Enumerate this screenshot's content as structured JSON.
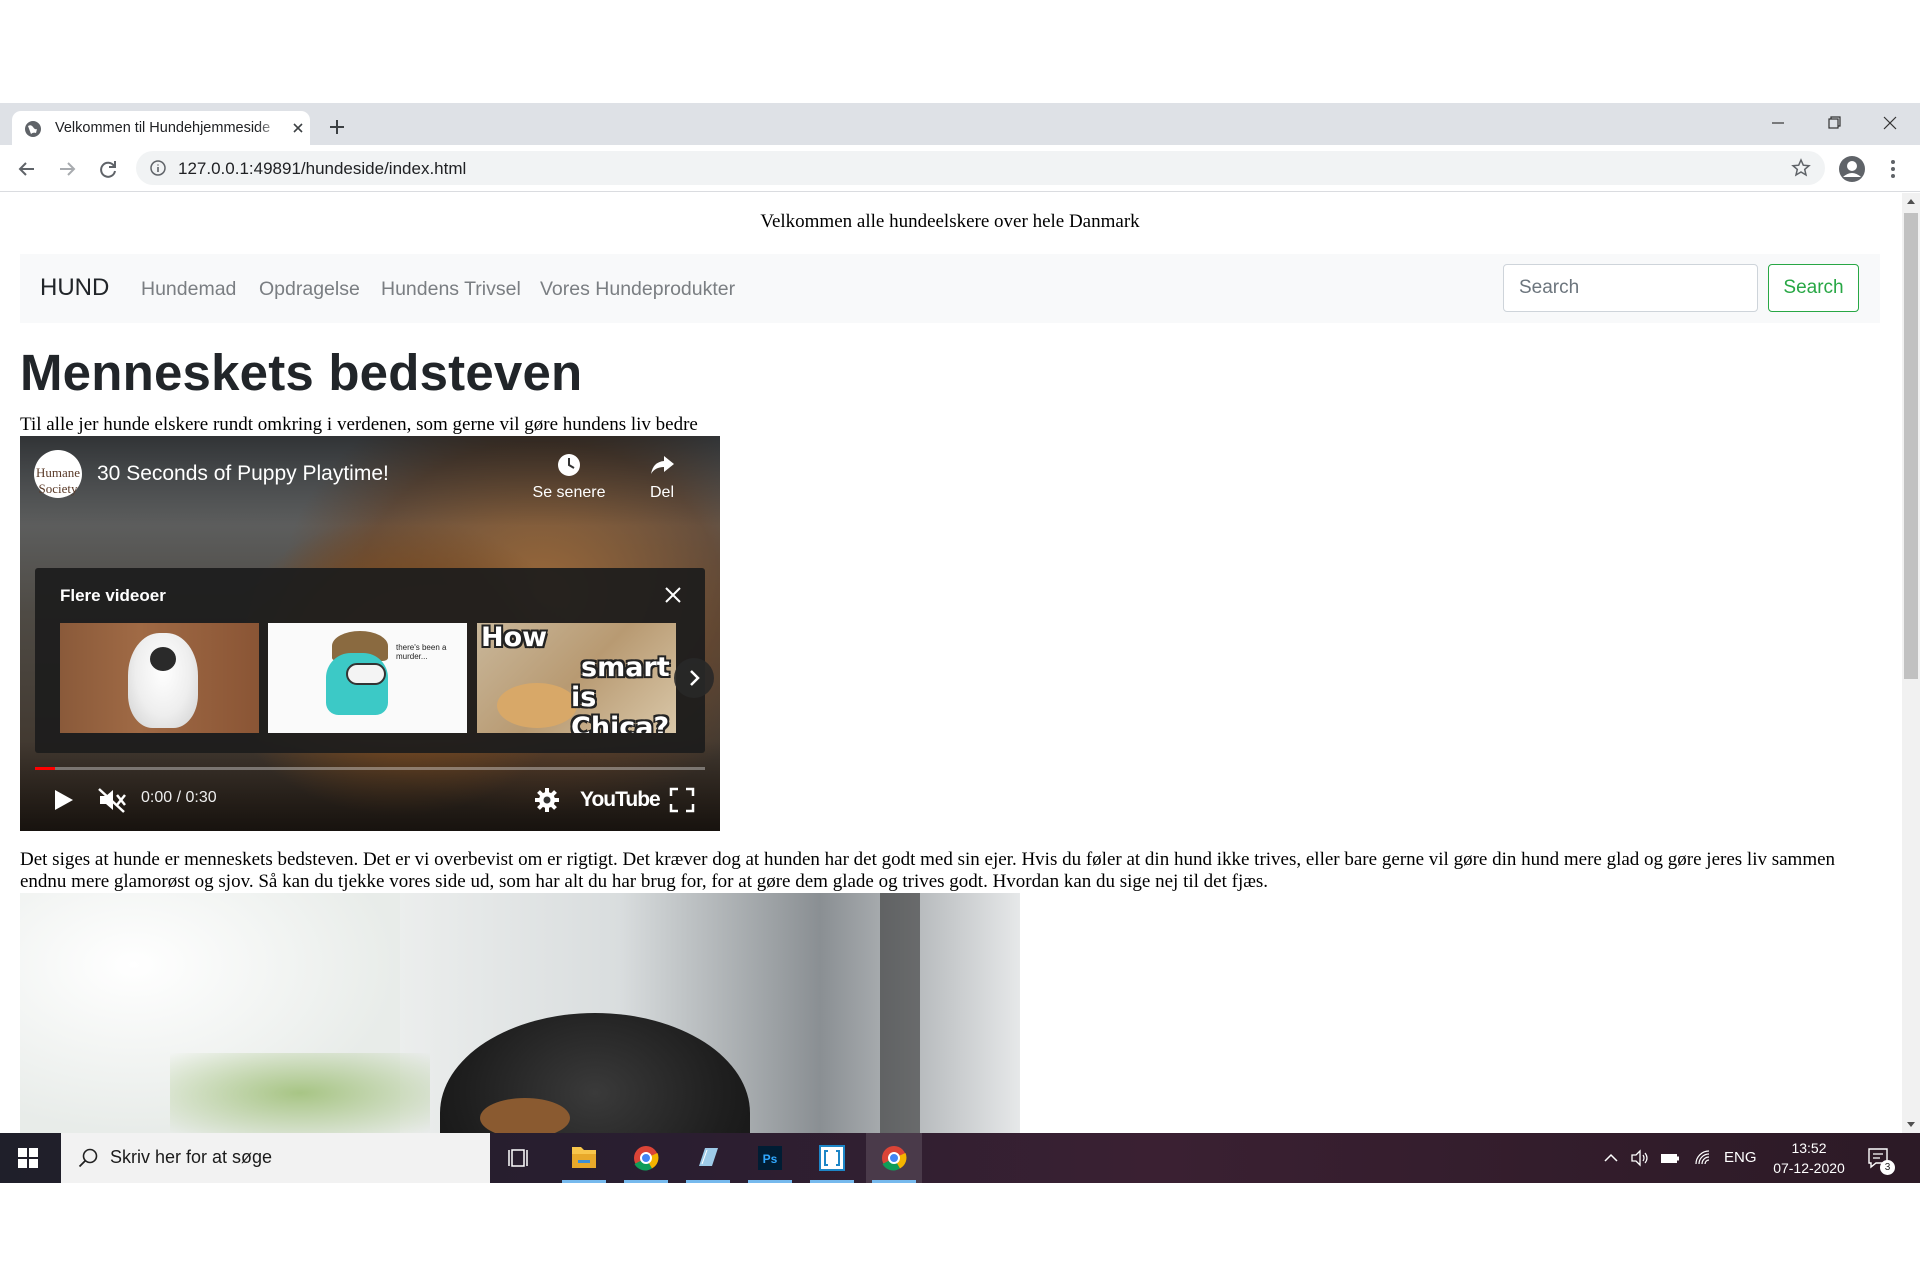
{
  "browser": {
    "tab_title": "Velkommen til Hundehjemmeside",
    "url": "127.0.0.1:49891/hundeside/index.html"
  },
  "page": {
    "welcome_text": "Velkommen alle hundeelskere over hele Danmark",
    "navbar": {
      "brand": "HUND",
      "links": [
        "Hundemad",
        "Opdragelse",
        "Hundens Trivsel",
        "Vores Hundeprodukter"
      ],
      "search_placeholder": "Search",
      "search_button": "Search"
    },
    "heading": "Menneskets bedsteven",
    "subtitle": "Til alle jer hunde elskere rundt omkring i verdenen, som gerne vil gøre hundens liv bedre",
    "video": {
      "channel_logo_text": "Humane Society",
      "title": "30 Seconds of Puppy Playtime!",
      "watch_later_label": "Se senere",
      "share_label": "Del",
      "more_videos_title": "Flere videoer",
      "thumbnails": [
        {
          "name": "white-monkey-thumbnail"
        },
        {
          "name": "among-us-detective-thumbnail",
          "caption": "there's been a murder..."
        },
        {
          "name": "smart-dog-thumbnail",
          "caption_lines": [
            "How",
            "smart",
            "is Chica?"
          ]
        }
      ],
      "time": "0:00 / 0:30",
      "progress": 0.03,
      "youtube_label": "YouTube"
    },
    "paragraph": "Det siges at hunde er menneskets bedsteven. Det er vi overbevist om er rigtigt. Det kræver dog at hunden har det godt med sin ejer. Hvis du føler at din hund ikke trives, eller bare gerne vil gøre din hund mere glad og gøre jeres liv sammen endnu mere glamorøst og sjov. Så kan du tjekke vores side ud, som har alt du har brug for, for at gøre dem glade og trives godt. Hvordan kan du sige nej til det fjæs."
  },
  "taskbar": {
    "search_placeholder": "Skriv her for at søge",
    "language": "ENG",
    "time": "13:52",
    "date": "07-12-2020",
    "notification_count": "3",
    "apps": [
      "task-view",
      "file-explorer",
      "chrome",
      "notepad",
      "photoshop",
      "brackets",
      "chrome"
    ]
  },
  "colors": {
    "accent_green": "#28a745",
    "youtube_red": "#ff0000",
    "navbar_bg": "#f8f9fa"
  }
}
